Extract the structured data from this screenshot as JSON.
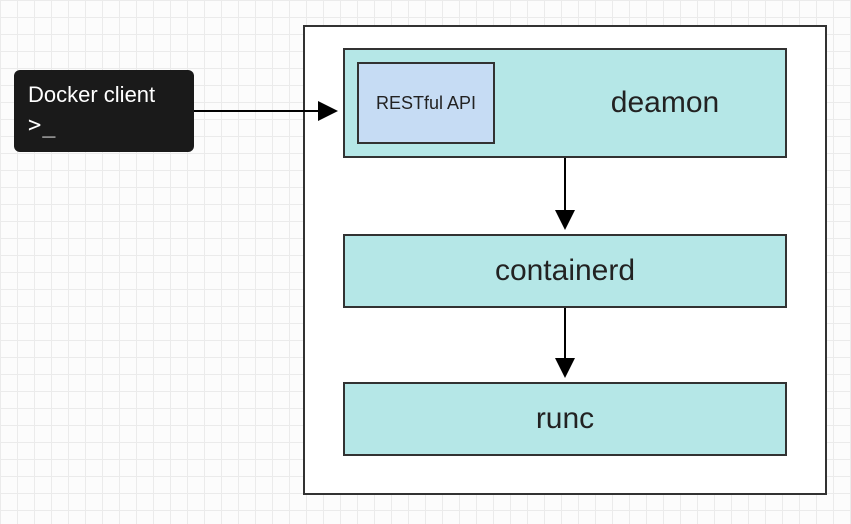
{
  "chart_data": {
    "type": "diagram",
    "title": "",
    "nodes": [
      {
        "id": "client",
        "label": "Docker client",
        "sub": ">_"
      },
      {
        "id": "api",
        "label": "RESTful API"
      },
      {
        "id": "daemon",
        "label": "deamon"
      },
      {
        "id": "containerd",
        "label": "containerd"
      },
      {
        "id": "runc",
        "label": "runc"
      }
    ],
    "edges": [
      {
        "from": "client",
        "to": "daemon"
      },
      {
        "from": "daemon",
        "to": "containerd"
      },
      {
        "from": "containerd",
        "to": "runc"
      }
    ]
  },
  "client": {
    "title": "Docker client",
    "prompt": ">_"
  },
  "api": {
    "label": "RESTful API"
  },
  "daemon": {
    "label": "deamon"
  },
  "containerd": {
    "label": "containerd"
  },
  "runc": {
    "label": "runc"
  }
}
